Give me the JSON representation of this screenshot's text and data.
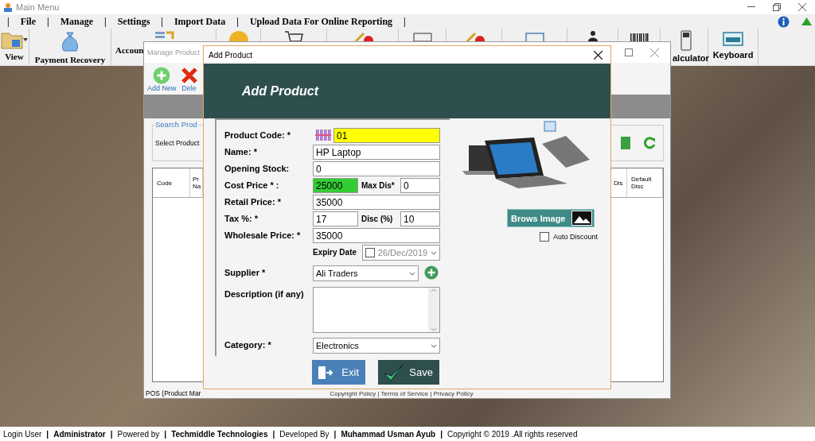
{
  "main_window": {
    "title": "Main Menu"
  },
  "menu": {
    "dividers": [
      "|",
      "|",
      "|",
      "|",
      "|",
      "|"
    ],
    "items": [
      {
        "label": "File"
      },
      {
        "label": "Manage"
      },
      {
        "label": "Settings"
      },
      {
        "label": "Import Data"
      },
      {
        "label": "Upload Data For Online Reporting"
      }
    ]
  },
  "toolbar": [
    {
      "kind": "dropdown",
      "label": "View"
    },
    {
      "kind": "labeled",
      "label": "Payment Recovery"
    },
    {
      "kind": "labeled",
      "label": "Accoun"
    },
    {
      "kind": "hidden"
    },
    {
      "kind": "hidden"
    },
    {
      "kind": "hidden"
    },
    {
      "kind": "hidden"
    },
    {
      "kind": "hidden"
    },
    {
      "kind": "hidden"
    },
    {
      "kind": "hidden"
    },
    {
      "kind": "hidden"
    },
    {
      "kind": "labeled",
      "label": "alculator"
    },
    {
      "kind": "labeled",
      "label": "Keyboard"
    }
  ],
  "manage_window": {
    "title": "Manage Product",
    "tools": [
      {
        "label": "Add New"
      },
      {
        "label": "Dele"
      }
    ],
    "group_title": "Search Prod",
    "select_label": "Select Product",
    "columns_left": [
      "Code",
      "Pr Na"
    ],
    "columns_right": [
      "Dis",
      "Default Disc"
    ],
    "status": "POS (Product Mar",
    "footer": "Copyright Policy | Terms of Service | Privacy Policy"
  },
  "dialog": {
    "title": "Add Product",
    "heading": "Add Product",
    "form": {
      "rows": [
        {
          "kind": "code",
          "label": "Product Code: *",
          "value": "01",
          "color": "#ffff00"
        },
        {
          "kind": "text",
          "label": "Name: *",
          "value": "HP Laptop"
        },
        {
          "kind": "text",
          "label": "Opening Stock:",
          "value": "0"
        },
        {
          "kind": "pair",
          "label": "Cost Price * :",
          "value": "25000",
          "color": "#33cc33",
          "label_2": "Max Dis*",
          "value_2": "0"
        },
        {
          "kind": "text",
          "label": "Retail Price: *",
          "value": "35000"
        },
        {
          "kind": "pair",
          "label": "Tax %: *",
          "value": "17",
          "label_2": "Disc (%)",
          "value_2": "10"
        },
        {
          "kind": "text",
          "label": "Wholesale Price: *",
          "value": "35000"
        },
        {
          "kind": "date",
          "label": "Expiry Date",
          "value": "26/Dec/2019",
          "checked": false
        },
        {
          "kind": "combo_add",
          "label": "Supplier *",
          "value": "Ali Traders"
        },
        {
          "kind": "textarea",
          "label": "Description (if any)"
        },
        {
          "kind": "combo",
          "label": "Category: *",
          "value": "Electronics"
        }
      ]
    },
    "browse_button": "Brows Image",
    "auto_discount": {
      "label": "Auto Discount",
      "checked": false
    },
    "buttons": [
      {
        "kind": "exit",
        "label": "Exit"
      },
      {
        "kind": "save",
        "label": "Save"
      }
    ]
  },
  "status_bar": {
    "dividers": [
      "|",
      "|",
      "|",
      "|",
      "|",
      "|"
    ],
    "items": [
      {
        "text": "Login User",
        "bold": false
      },
      {
        "text": "Administrator",
        "bold": true
      },
      {
        "text": "Powered by",
        "bold": false
      },
      {
        "text": "Techmiddle Technologies",
        "bold": true
      },
      {
        "text": "Developed By",
        "bold": false
      },
      {
        "text": "Muhammad Usman Ayub",
        "bold": true
      },
      {
        "text": "Copyright © 2019  .All rights reserved",
        "bold": false
      }
    ]
  }
}
